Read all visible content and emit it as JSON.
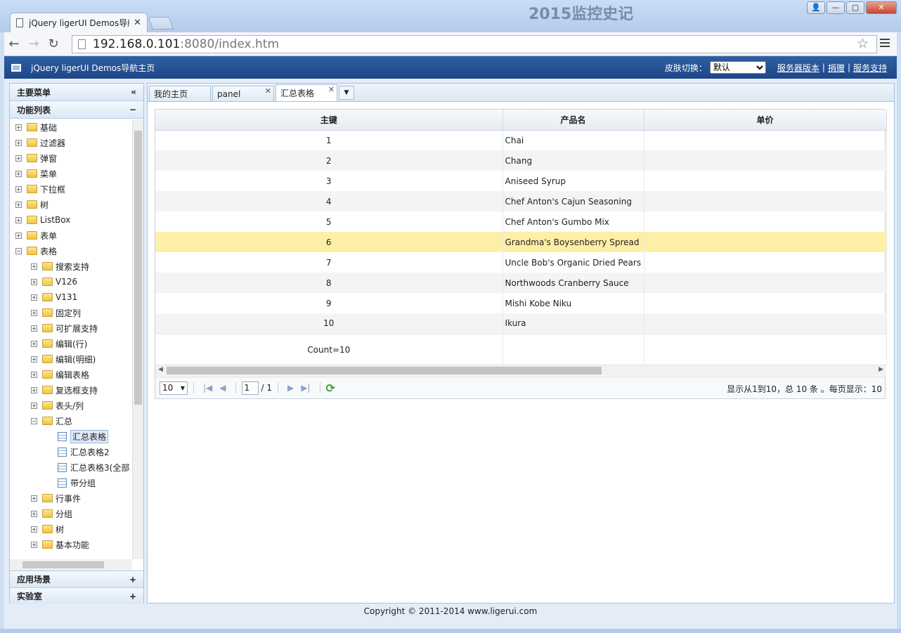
{
  "browser": {
    "tab_title": "jQuery ligerUI Demos导航",
    "url_host": "192.168.0.101",
    "url_rest": ":8080/index.htm",
    "background_text": "2015监控史记"
  },
  "header": {
    "title": "jQuery ligerUI Demos导航主页",
    "skin_label": "皮肤切换：",
    "skin_value": "默认",
    "links": [
      "服务器版本",
      "捐赠",
      "服务支持"
    ]
  },
  "left": {
    "main_menu": "主要菜单",
    "function_list": "功能列表",
    "tree_top": [
      "基础",
      "过滤器",
      "弹窗",
      "菜单",
      "下拉框",
      "树",
      "ListBox",
      "表单",
      "表格"
    ],
    "tree_grid": [
      "搜索支持",
      "V126",
      "V131",
      "固定列",
      "可扩展支持",
      "编辑(行)",
      "编辑(明细)",
      "编辑表格",
      "复选框支持",
      "表头/列",
      "汇总"
    ],
    "tree_summary": [
      "汇总表格",
      "汇总表格2",
      "汇总表格3(全部",
      "带分组"
    ],
    "tree_after": [
      "行事件",
      "分组",
      "树",
      "基本功能"
    ],
    "accordion": [
      "应用场景",
      "实验室"
    ]
  },
  "tabs": [
    "我的主页",
    "panel",
    "汇总表格"
  ],
  "grid": {
    "columns": [
      "主键",
      "产品名",
      "单价"
    ],
    "rows": [
      {
        "id": "1",
        "name": "Chai"
      },
      {
        "id": "2",
        "name": "Chang"
      },
      {
        "id": "3",
        "name": "Aniseed Syrup"
      },
      {
        "id": "4",
        "name": "Chef Anton's Cajun Seasoning"
      },
      {
        "id": "5",
        "name": "Chef Anton's Gumbo Mix"
      },
      {
        "id": "6",
        "name": "Grandma's Boysenberry Spread"
      },
      {
        "id": "7",
        "name": "Uncle Bob's Organic Dried Pears"
      },
      {
        "id": "8",
        "name": "Northwoods Cranberry Sauce"
      },
      {
        "id": "9",
        "name": "Mishi Kobe Niku"
      },
      {
        "id": "10",
        "name": "Ikura"
      }
    ],
    "summary": "Count=10",
    "selected_row": 6
  },
  "pager": {
    "page_size": "10",
    "page_value": "1",
    "page_total": "/ 1",
    "info": "显示从1到10，总 10 条 。每页显示：10"
  },
  "footer": "Copyright © 2011-2014 www.ligerui.com"
}
